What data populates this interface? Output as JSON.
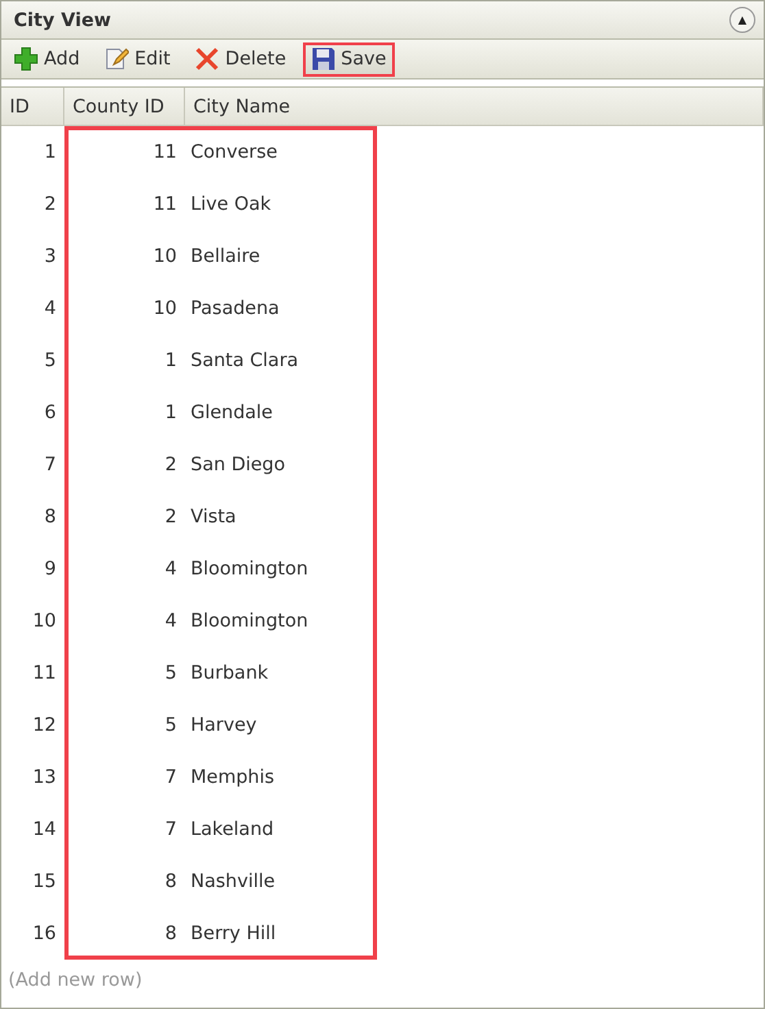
{
  "panel": {
    "title": "City View",
    "collapse_glyph": "▲"
  },
  "toolbar": [
    {
      "kind": "add",
      "label": "Add",
      "highlighted": false
    },
    {
      "kind": "edit",
      "label": "Edit",
      "highlighted": false
    },
    {
      "kind": "delete",
      "label": "Delete",
      "highlighted": false
    },
    {
      "kind": "save",
      "label": "Save",
      "highlighted": true
    }
  ],
  "table": {
    "highlighted": true,
    "columns": [
      {
        "label": "ID"
      },
      {
        "label": "County ID"
      },
      {
        "label": "City Name"
      }
    ],
    "rows": [
      [
        "1",
        "11",
        "Converse"
      ],
      [
        "2",
        "11",
        "Live Oak"
      ],
      [
        "3",
        "10",
        "Bellaire"
      ],
      [
        "4",
        "10",
        "Pasadena"
      ],
      [
        "5",
        "1",
        "Santa Clara"
      ],
      [
        "6",
        "1",
        "Glendale"
      ],
      [
        "7",
        "2",
        "San Diego"
      ],
      [
        "8",
        "2",
        "Vista"
      ],
      [
        "9",
        "4",
        "Bloomington"
      ],
      [
        "10",
        "4",
        "Bloomington"
      ],
      [
        "11",
        "5",
        "Burbank"
      ],
      [
        "12",
        "5",
        "Harvey"
      ],
      [
        "13",
        "7",
        "Memphis"
      ],
      [
        "14",
        "7",
        "Lakeland"
      ],
      [
        "15",
        "8",
        "Nashville"
      ],
      [
        "16",
        "8",
        "Berry Hill"
      ]
    ],
    "add_row": "(Add new row)"
  }
}
